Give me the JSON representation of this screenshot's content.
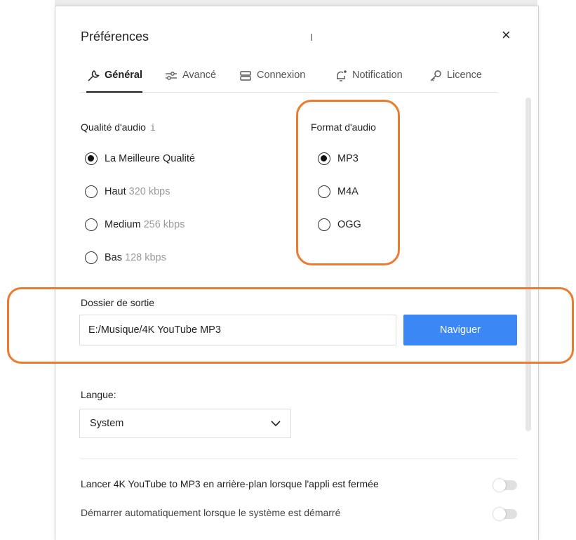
{
  "dialog": {
    "title": "Préférences",
    "close_symbol": "×"
  },
  "tabs": [
    {
      "label": "Général",
      "icon": "wrench-icon",
      "active": true
    },
    {
      "label": "Avancé",
      "icon": "sliders-icon",
      "active": false
    },
    {
      "label": "Connexion",
      "icon": "server-icon",
      "active": false
    },
    {
      "label": "Notification",
      "icon": "bell-icon",
      "active": false
    },
    {
      "label": "Licence",
      "icon": "key-icon",
      "active": false
    }
  ],
  "quality": {
    "label": "Qualité d'audio",
    "info": "i",
    "options": [
      {
        "name": "La Meilleure Qualité",
        "detail": "",
        "checked": true
      },
      {
        "name": "Haut",
        "detail": "320 kbps",
        "checked": false
      },
      {
        "name": "Medium",
        "detail": "256 kbps",
        "checked": false
      },
      {
        "name": "Bas",
        "detail": "128 kbps",
        "checked": false
      }
    ]
  },
  "format": {
    "label": "Format d'audio",
    "options": [
      {
        "name": "MP3",
        "checked": true
      },
      {
        "name": "M4A",
        "checked": false
      },
      {
        "name": "OGG",
        "checked": false
      }
    ]
  },
  "output": {
    "label": "Dossier de sortie",
    "path": "E:/Musique/4K YouTube MP3",
    "browse_label": "Naviguer"
  },
  "language": {
    "label": "Langue:",
    "value": "System"
  },
  "options": [
    {
      "label": "Lancer 4K YouTube to MP3 en arrière-plan lorsque l'appli est fermée",
      "enabled": false
    },
    {
      "label": "Démarrer automatiquement lorsque le système est démarré",
      "enabled": false
    }
  ],
  "colors": {
    "accent": "#3b87f5",
    "highlight": "#ea7b30"
  }
}
